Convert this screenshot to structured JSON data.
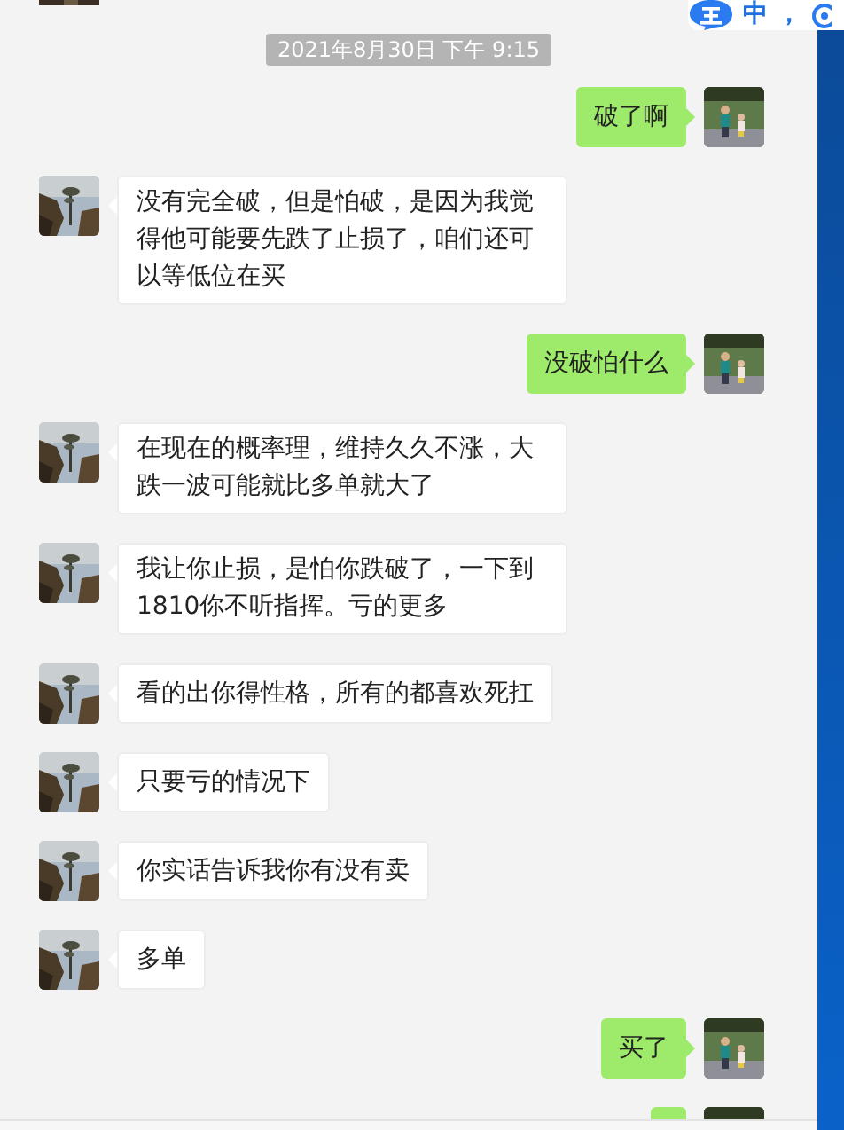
{
  "ime_toolbar": {
    "mode": "中",
    "punctuation": "，"
  },
  "date_label": "2021年8月30日 下午 9:15",
  "messages": [
    {
      "kind": "sent",
      "text": "破了啊"
    },
    {
      "kind": "received",
      "text": "没有完全破，但是怕破，是因为我觉得他可能要先跌了止损了，咱们还可以等低位在买"
    },
    {
      "kind": "sent",
      "text": "没破怕什么"
    },
    {
      "kind": "received",
      "text": "在现在的概率理，维持久久不涨，大跌一波可能就比多单就大了"
    },
    {
      "kind": "received",
      "text": "我让你止损，是怕你跌破了，一下到1810你不听指挥。亏的更多"
    },
    {
      "kind": "received",
      "text": "看的出你得性格，所有的都喜欢死扛"
    },
    {
      "kind": "received",
      "text": "只要亏的情况下"
    },
    {
      "kind": "received",
      "text": "你实话告诉我你有没有卖"
    },
    {
      "kind": "received",
      "text": "多单"
    },
    {
      "kind": "sent",
      "text": "买了"
    },
    {
      "kind": "sent"
    }
  ]
}
